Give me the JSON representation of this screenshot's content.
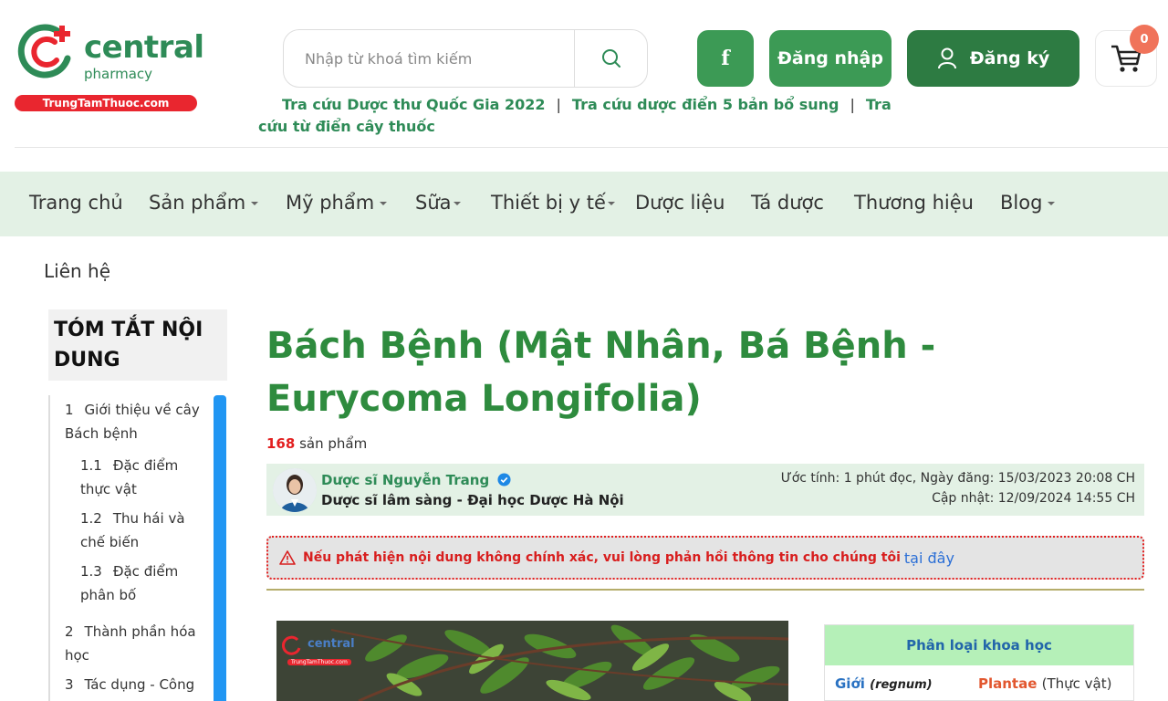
{
  "brand": {
    "name": "central",
    "sub": "pharmacy",
    "banner": "TrungTamThuoc.com",
    "colors": {
      "green": "#2e8b57",
      "red": "#e9262f"
    }
  },
  "search": {
    "placeholder": "Nhập từ khoá tìm kiếm",
    "value": ""
  },
  "header": {
    "facebook_label": "f",
    "login_label": "Đăng nhập",
    "register_label": "Đăng ký",
    "cart_count": "0"
  },
  "quicklinks": [
    "Tra cứu Dược thư Quốc Gia 2022",
    "Tra cứu dược điển 5 bản bổ sung",
    "Tra cứu từ điển cây thuốc"
  ],
  "nav": {
    "items": [
      {
        "label": "Trang chủ"
      },
      {
        "label": "Sản phẩm"
      },
      {
        "label": "Mỹ phẩm"
      },
      {
        "label": "Sữa"
      },
      {
        "label": "Thiết bị y tế"
      },
      {
        "label": "Dược liệu"
      },
      {
        "label": "Tá dược"
      },
      {
        "label": "Thương hiệu"
      },
      {
        "label": "Blog"
      },
      {
        "label": "Liên hệ"
      }
    ]
  },
  "toc": {
    "title": "TÓM TẮT NỘI DUNG",
    "items": [
      {
        "num": "1",
        "text": "Giới thiệu về cây Bách bệnh"
      },
      {
        "num": "1.1",
        "text": "Đặc điểm thực vật"
      },
      {
        "num": "1.2",
        "text": "Thu hái và chế biến"
      },
      {
        "num": "1.3",
        "text": "Đặc điểm phân bố"
      },
      {
        "num": "2",
        "text": "Thành phần hóa học"
      },
      {
        "num": "3",
        "text": "Tác dụng - Công"
      }
    ]
  },
  "article": {
    "title": "Bách Bệnh (Mật Nhân, Bá Bệnh - Eurycoma Longifolia)",
    "product_count": "168",
    "product_count_suffix": "sản phẩm",
    "author": {
      "name": "Dược sĩ Nguyễn Trang",
      "role": "Dược sĩ lâm sàng - Đại học Dược Hà Nội",
      "meta_published": "Ước tính: 1 phút đọc, Ngày đăng: 15/03/2023 20:08 CH",
      "meta_updated": "Cập nhật: 12/09/2024 14:55 CH"
    },
    "warning": {
      "text": "Nếu phát hiện nội dung không chính xác, vui lòng phản hồi thông tin cho chúng tôi",
      "link": "tại đây"
    },
    "image_watermark": "central",
    "image_watermark_sub": "TrungTamThuoc.com",
    "classification": {
      "title": "Phân loại khoa học",
      "rows": [
        {
          "key": "Giới",
          "key_latin": "(regnum)",
          "value": "Plantae",
          "value_note": "(Thực vật)"
        }
      ]
    }
  }
}
